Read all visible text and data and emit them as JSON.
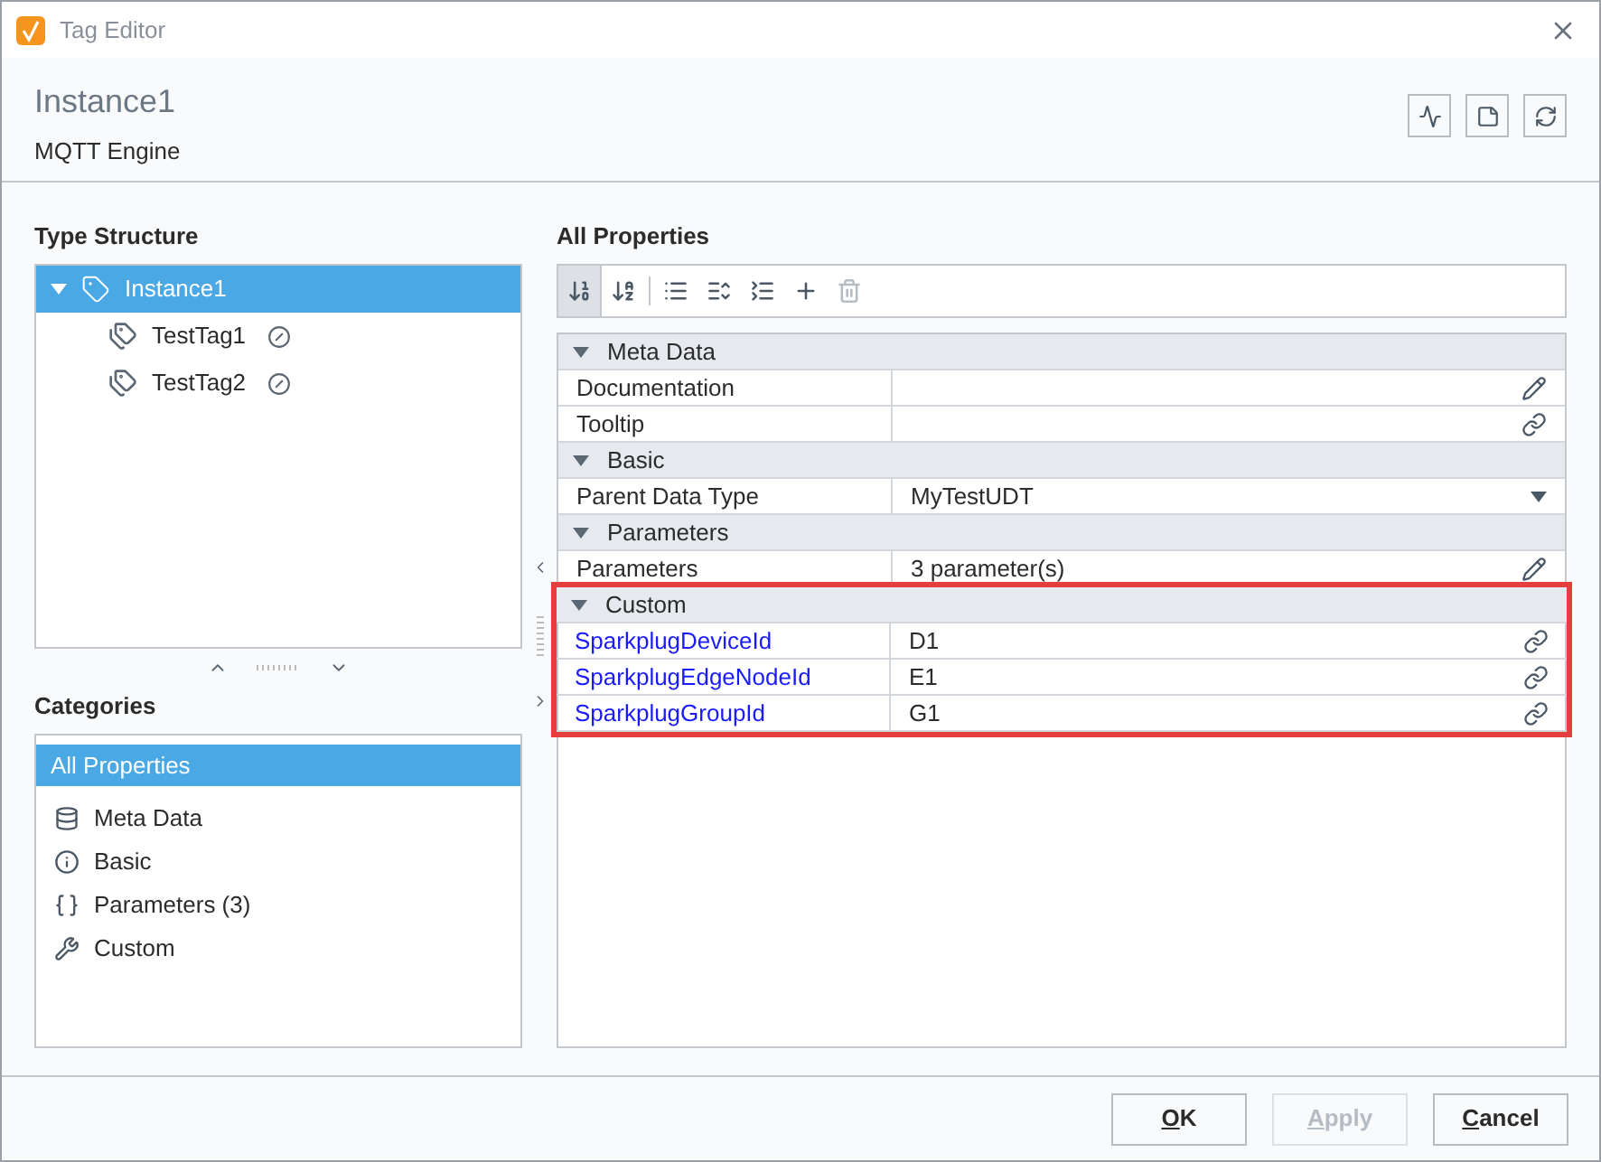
{
  "window": {
    "title": "Tag Editor"
  },
  "header": {
    "title": "Instance1",
    "subtitle": "MQTT Engine"
  },
  "type_structure": {
    "title": "Type Structure",
    "tree": [
      {
        "label": "Instance1",
        "selected": true,
        "expanded": true,
        "children": [
          {
            "label": "TestTag1",
            "selected": false
          },
          {
            "label": "TestTag2",
            "selected": false
          }
        ]
      }
    ]
  },
  "categories": {
    "title": "Categories",
    "items": [
      {
        "label": "All Properties",
        "kind": "all",
        "selected": true
      },
      {
        "label": "Meta Data",
        "kind": "meta",
        "selected": false
      },
      {
        "label": "Basic",
        "kind": "basic",
        "selected": false
      },
      {
        "label": "Parameters (3)",
        "kind": "params",
        "selected": false
      },
      {
        "label": "Custom",
        "kind": "custom",
        "selected": false
      }
    ]
  },
  "properties": {
    "title": "All Properties",
    "toolbar": [
      {
        "kind": "sort-category",
        "selected": true,
        "disabled": false
      },
      {
        "kind": "sort-name",
        "selected": false,
        "disabled": false
      },
      {
        "kind": "separator"
      },
      {
        "kind": "list",
        "selected": false,
        "disabled": false
      },
      {
        "kind": "expand",
        "selected": false,
        "disabled": false
      },
      {
        "kind": "collapse",
        "selected": false,
        "disabled": false
      },
      {
        "kind": "add",
        "selected": false,
        "disabled": false
      },
      {
        "kind": "delete",
        "selected": false,
        "disabled": true
      }
    ],
    "groups": [
      {
        "label": "Meta Data",
        "expanded": true,
        "highlighted": false,
        "rows": [
          {
            "name": "Documentation",
            "value": "",
            "kind": "edit",
            "custom": false
          },
          {
            "name": "Tooltip",
            "value": "",
            "kind": "link",
            "custom": false
          }
        ]
      },
      {
        "label": "Basic",
        "expanded": true,
        "highlighted": false,
        "rows": [
          {
            "name": "Parent Data Type",
            "value": "MyTestUDT",
            "kind": "select",
            "custom": false
          }
        ]
      },
      {
        "label": "Parameters",
        "expanded": true,
        "highlighted": false,
        "rows": [
          {
            "name": "Parameters",
            "value": "3 parameter(s)",
            "kind": "edit",
            "custom": false
          }
        ]
      },
      {
        "label": "Custom",
        "expanded": true,
        "highlighted": true,
        "rows": [
          {
            "name": "SparkplugDeviceId",
            "value": "D1",
            "kind": "link",
            "custom": true
          },
          {
            "name": "SparkplugEdgeNodeId",
            "value": "E1",
            "kind": "link",
            "custom": true
          },
          {
            "name": "SparkplugGroupId",
            "value": "G1",
            "kind": "link",
            "custom": true
          }
        ]
      }
    ]
  },
  "buttons": [
    {
      "label": "OK",
      "disabled": false
    },
    {
      "label": "Apply",
      "disabled": true
    },
    {
      "label": "Cancel",
      "disabled": false
    }
  ]
}
